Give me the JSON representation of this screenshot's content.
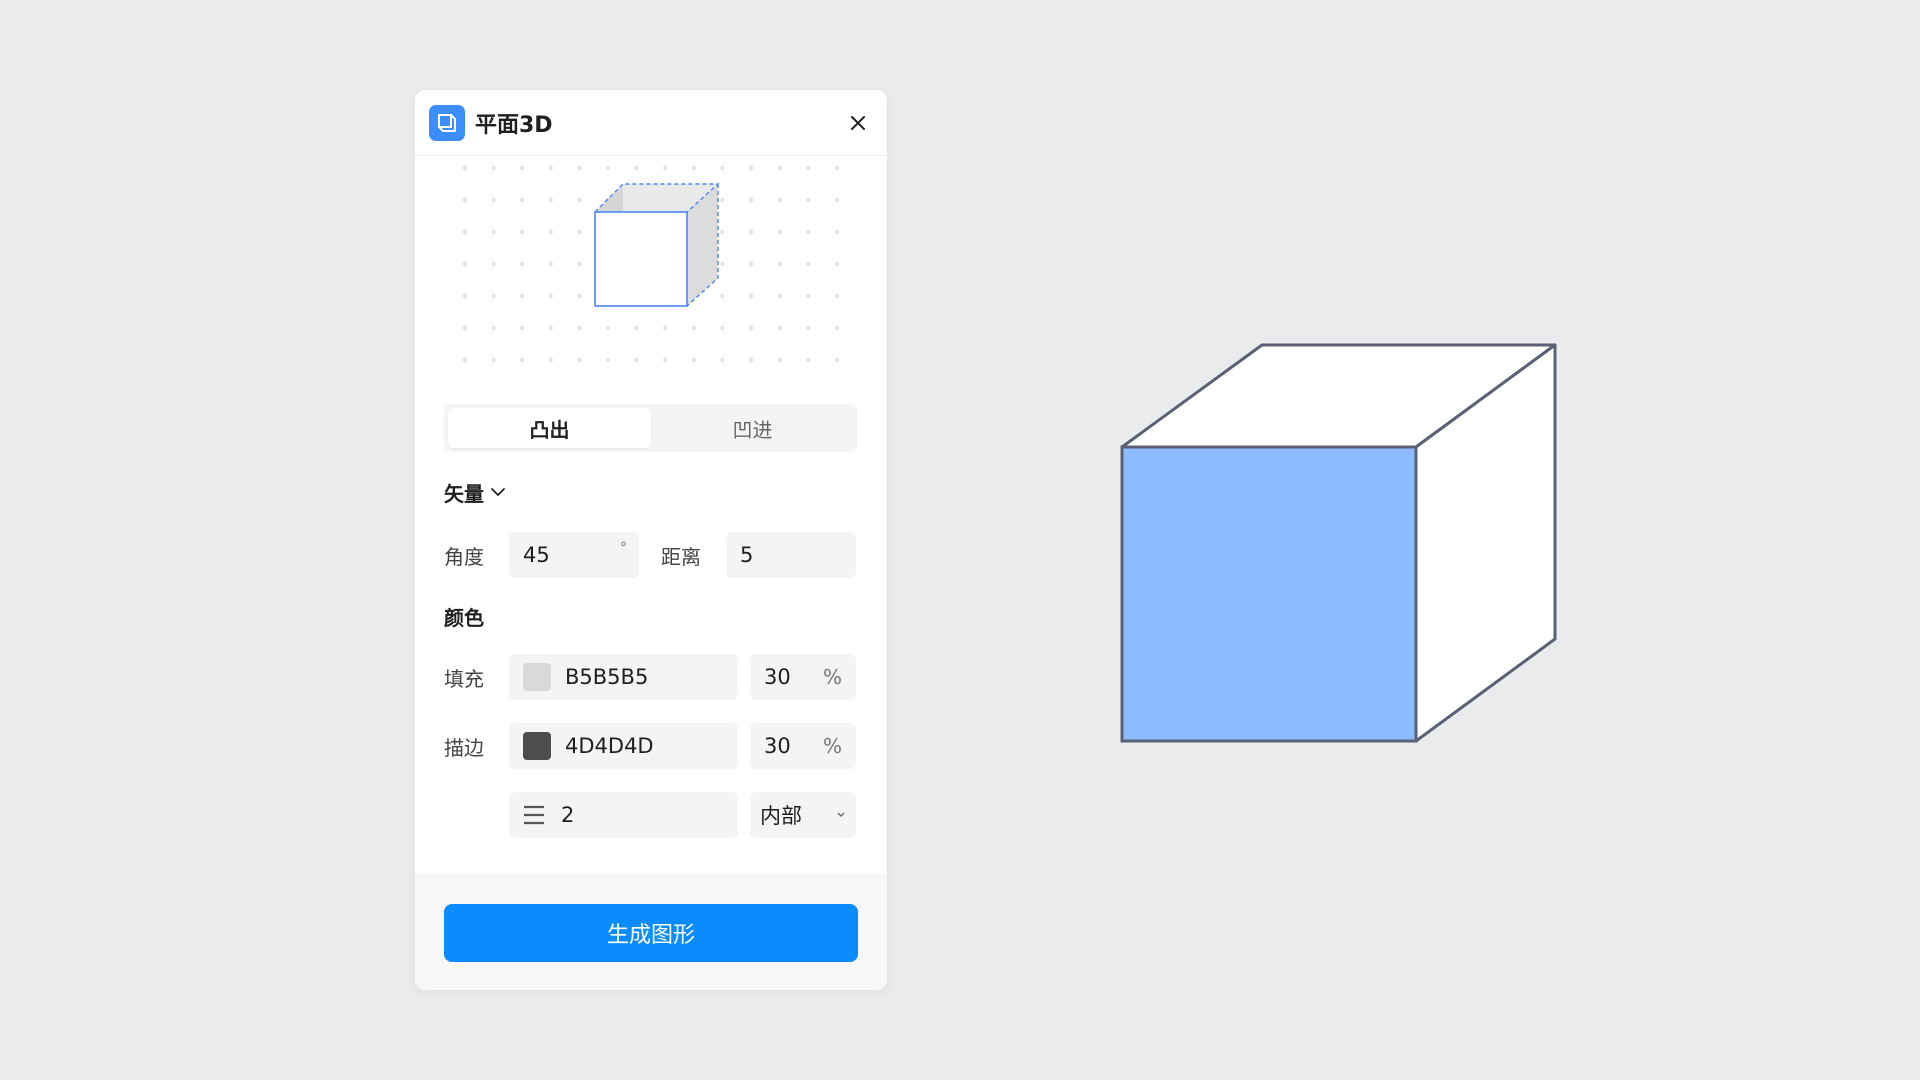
{
  "app": {
    "title": "平面3D",
    "icon": "cube-app-icon"
  },
  "modes": {
    "items": [
      "凸出",
      "凹进"
    ],
    "active_index": 0
  },
  "vector": {
    "section_label": "矢量",
    "angle_label": "角度",
    "angle_value": "45",
    "angle_unit": "°",
    "distance_label": "距离",
    "distance_value": "5"
  },
  "color": {
    "section_label": "颜色",
    "fill_label": "填充",
    "fill_hex": "B5B5B5",
    "fill_swatch": "#D9D9D9",
    "fill_opacity": "30",
    "stroke_label": "描边",
    "stroke_hex": "4D4D4D",
    "stroke_swatch": "#4D4D4D",
    "stroke_opacity": "30",
    "percent_unit": "%",
    "stroke_width": "2",
    "stroke_position": "内部"
  },
  "actions": {
    "generate_label": "生成图形"
  },
  "colors": {
    "accent": "#0A8CFF",
    "app_icon": "#3C8DFF",
    "cube_front": "#8CBCFF",
    "cube_outline": "#5B6075",
    "background": "#EAEBED"
  }
}
